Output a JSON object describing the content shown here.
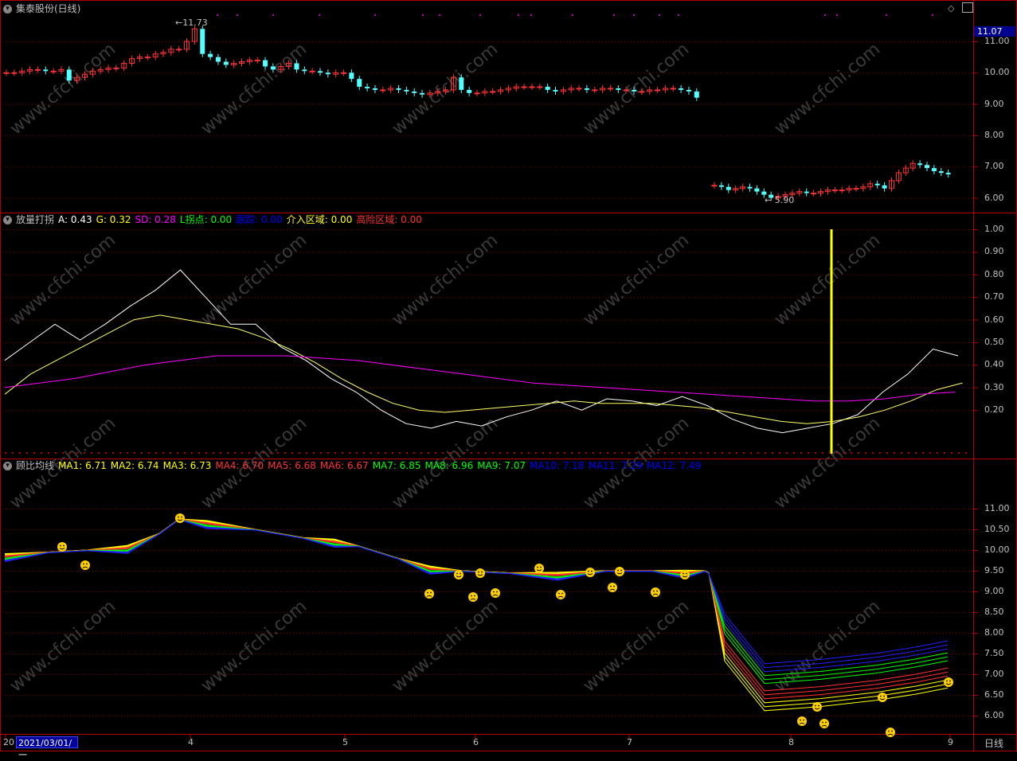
{
  "title_bar": {
    "stock": "集泰股份(日线)"
  },
  "price_panel": {
    "current_price": "11.07",
    "high_label": "11.73",
    "low_label": "5.90",
    "y_ticks": [
      "11.00",
      "10.00",
      "9.00",
      "8.00",
      "7.00",
      "6.00"
    ]
  },
  "indicator1": {
    "name": "放量打拐",
    "values": [
      {
        "text": "A: 0.43",
        "color": "#ffffff"
      },
      {
        "text": "G: 0.32",
        "color": "#ffff00"
      },
      {
        "text": "SD: 0.28",
        "color": "#ff00ff"
      },
      {
        "text": "L拐点: 0.00",
        "color": "#00ff00"
      },
      {
        "text": "跟踪: 0.00",
        "color": "#0000ff"
      },
      {
        "text": "介入区域: 0.00",
        "color": "#ffff00"
      },
      {
        "text": "高险区域: 0.00",
        "color": "#ff3333"
      }
    ],
    "y_ticks": [
      "1.00",
      "0.90",
      "0.80",
      "0.70",
      "0.60",
      "0.50",
      "0.40",
      "0.30",
      "0.20"
    ]
  },
  "indicator2": {
    "name": "顾比均线",
    "values": [
      {
        "text": "MA1: 6.71",
        "color": "#ffff00"
      },
      {
        "text": "MA2: 6.74",
        "color": "#ffff00"
      },
      {
        "text": "MA3: 6.73",
        "color": "#ffff00"
      },
      {
        "text": "MA4: 6.70",
        "color": "#ff3333"
      },
      {
        "text": "MA5: 6.68",
        "color": "#ff3333"
      },
      {
        "text": "MA6: 6.67",
        "color": "#ff3333"
      },
      {
        "text": "MA7: 6.85",
        "color": "#00ff00"
      },
      {
        "text": "MA8: 6.96",
        "color": "#00ff00"
      },
      {
        "text": "MA9: 7.07",
        "color": "#00ff00"
      },
      {
        "text": "MA10: 7.18",
        "color": "#0000ff"
      },
      {
        "text": "MA11: 7.29",
        "color": "#0000ff"
      },
      {
        "text": "MA12: 7.49",
        "color": "#0000ff"
      }
    ],
    "y_ticks": [
      "11.00",
      "10.50",
      "10.00",
      "9.50",
      "9.00",
      "8.50",
      "8.00",
      "7.50",
      "7.00",
      "6.50",
      "6.00"
    ]
  },
  "x_axis": {
    "ticks": [
      "20",
      "4",
      "5",
      "6",
      "7",
      "8",
      "9"
    ],
    "date_box": "2021/03/01/一",
    "period": "日线"
  },
  "watermark": "www.cfchi.com",
  "colors": {
    "up": "#ff3333",
    "down": "#54ffff",
    "grid": "#8b0000",
    "border": "#b00000"
  }
}
